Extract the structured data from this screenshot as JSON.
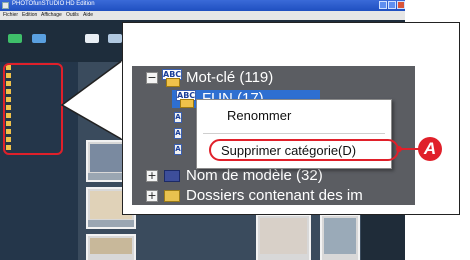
{
  "app": {
    "title": "PHOTOfunSTUDIO HD Edition",
    "menu": [
      "Fichier",
      "Edition",
      "Affichage",
      "Outils",
      "Aide"
    ]
  },
  "callout": {
    "tree": {
      "keyword_node": "Mot-clé (119)",
      "selected_item": "FUN (17)",
      "model_node": "Nom de modèle (32)",
      "folders_node": "Dossiers contenant des im"
    },
    "context_menu": {
      "items": [
        "Renommer",
        "Supprimer catégorie(D)"
      ]
    },
    "badge": "A"
  },
  "colors": {
    "accent_red": "#e0202a",
    "selection_blue": "#2e6fd1"
  }
}
